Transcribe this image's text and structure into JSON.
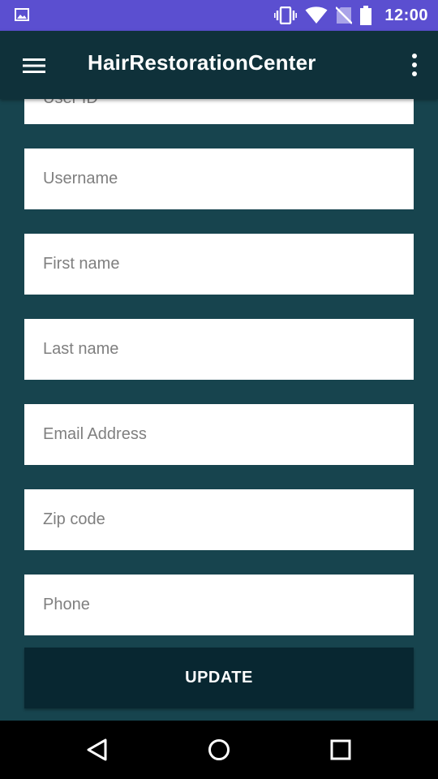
{
  "status_bar": {
    "time": "12:00",
    "background": "#5b4fd0",
    "icons": [
      "image-icon",
      "vibrate-icon",
      "wifi-icon",
      "no-sim-icon",
      "battery-icon"
    ]
  },
  "app_bar": {
    "title": "HairRestorationCenter",
    "background": "#0f313a"
  },
  "form": {
    "partial_field": {
      "label": "User ID"
    },
    "fields": [
      {
        "name": "username",
        "placeholder": "Username",
        "value": ""
      },
      {
        "name": "first-name",
        "placeholder": "First name",
        "value": ""
      },
      {
        "name": "last-name",
        "placeholder": "Last name",
        "value": ""
      },
      {
        "name": "email",
        "placeholder": "Email Address",
        "value": ""
      },
      {
        "name": "zip-code",
        "placeholder": "Zip code",
        "value": ""
      },
      {
        "name": "phone",
        "placeholder": "Phone",
        "value": ""
      }
    ],
    "update_label": "UPDATE"
  },
  "colors": {
    "content_background": "#17444e",
    "button_background": "#082731"
  }
}
